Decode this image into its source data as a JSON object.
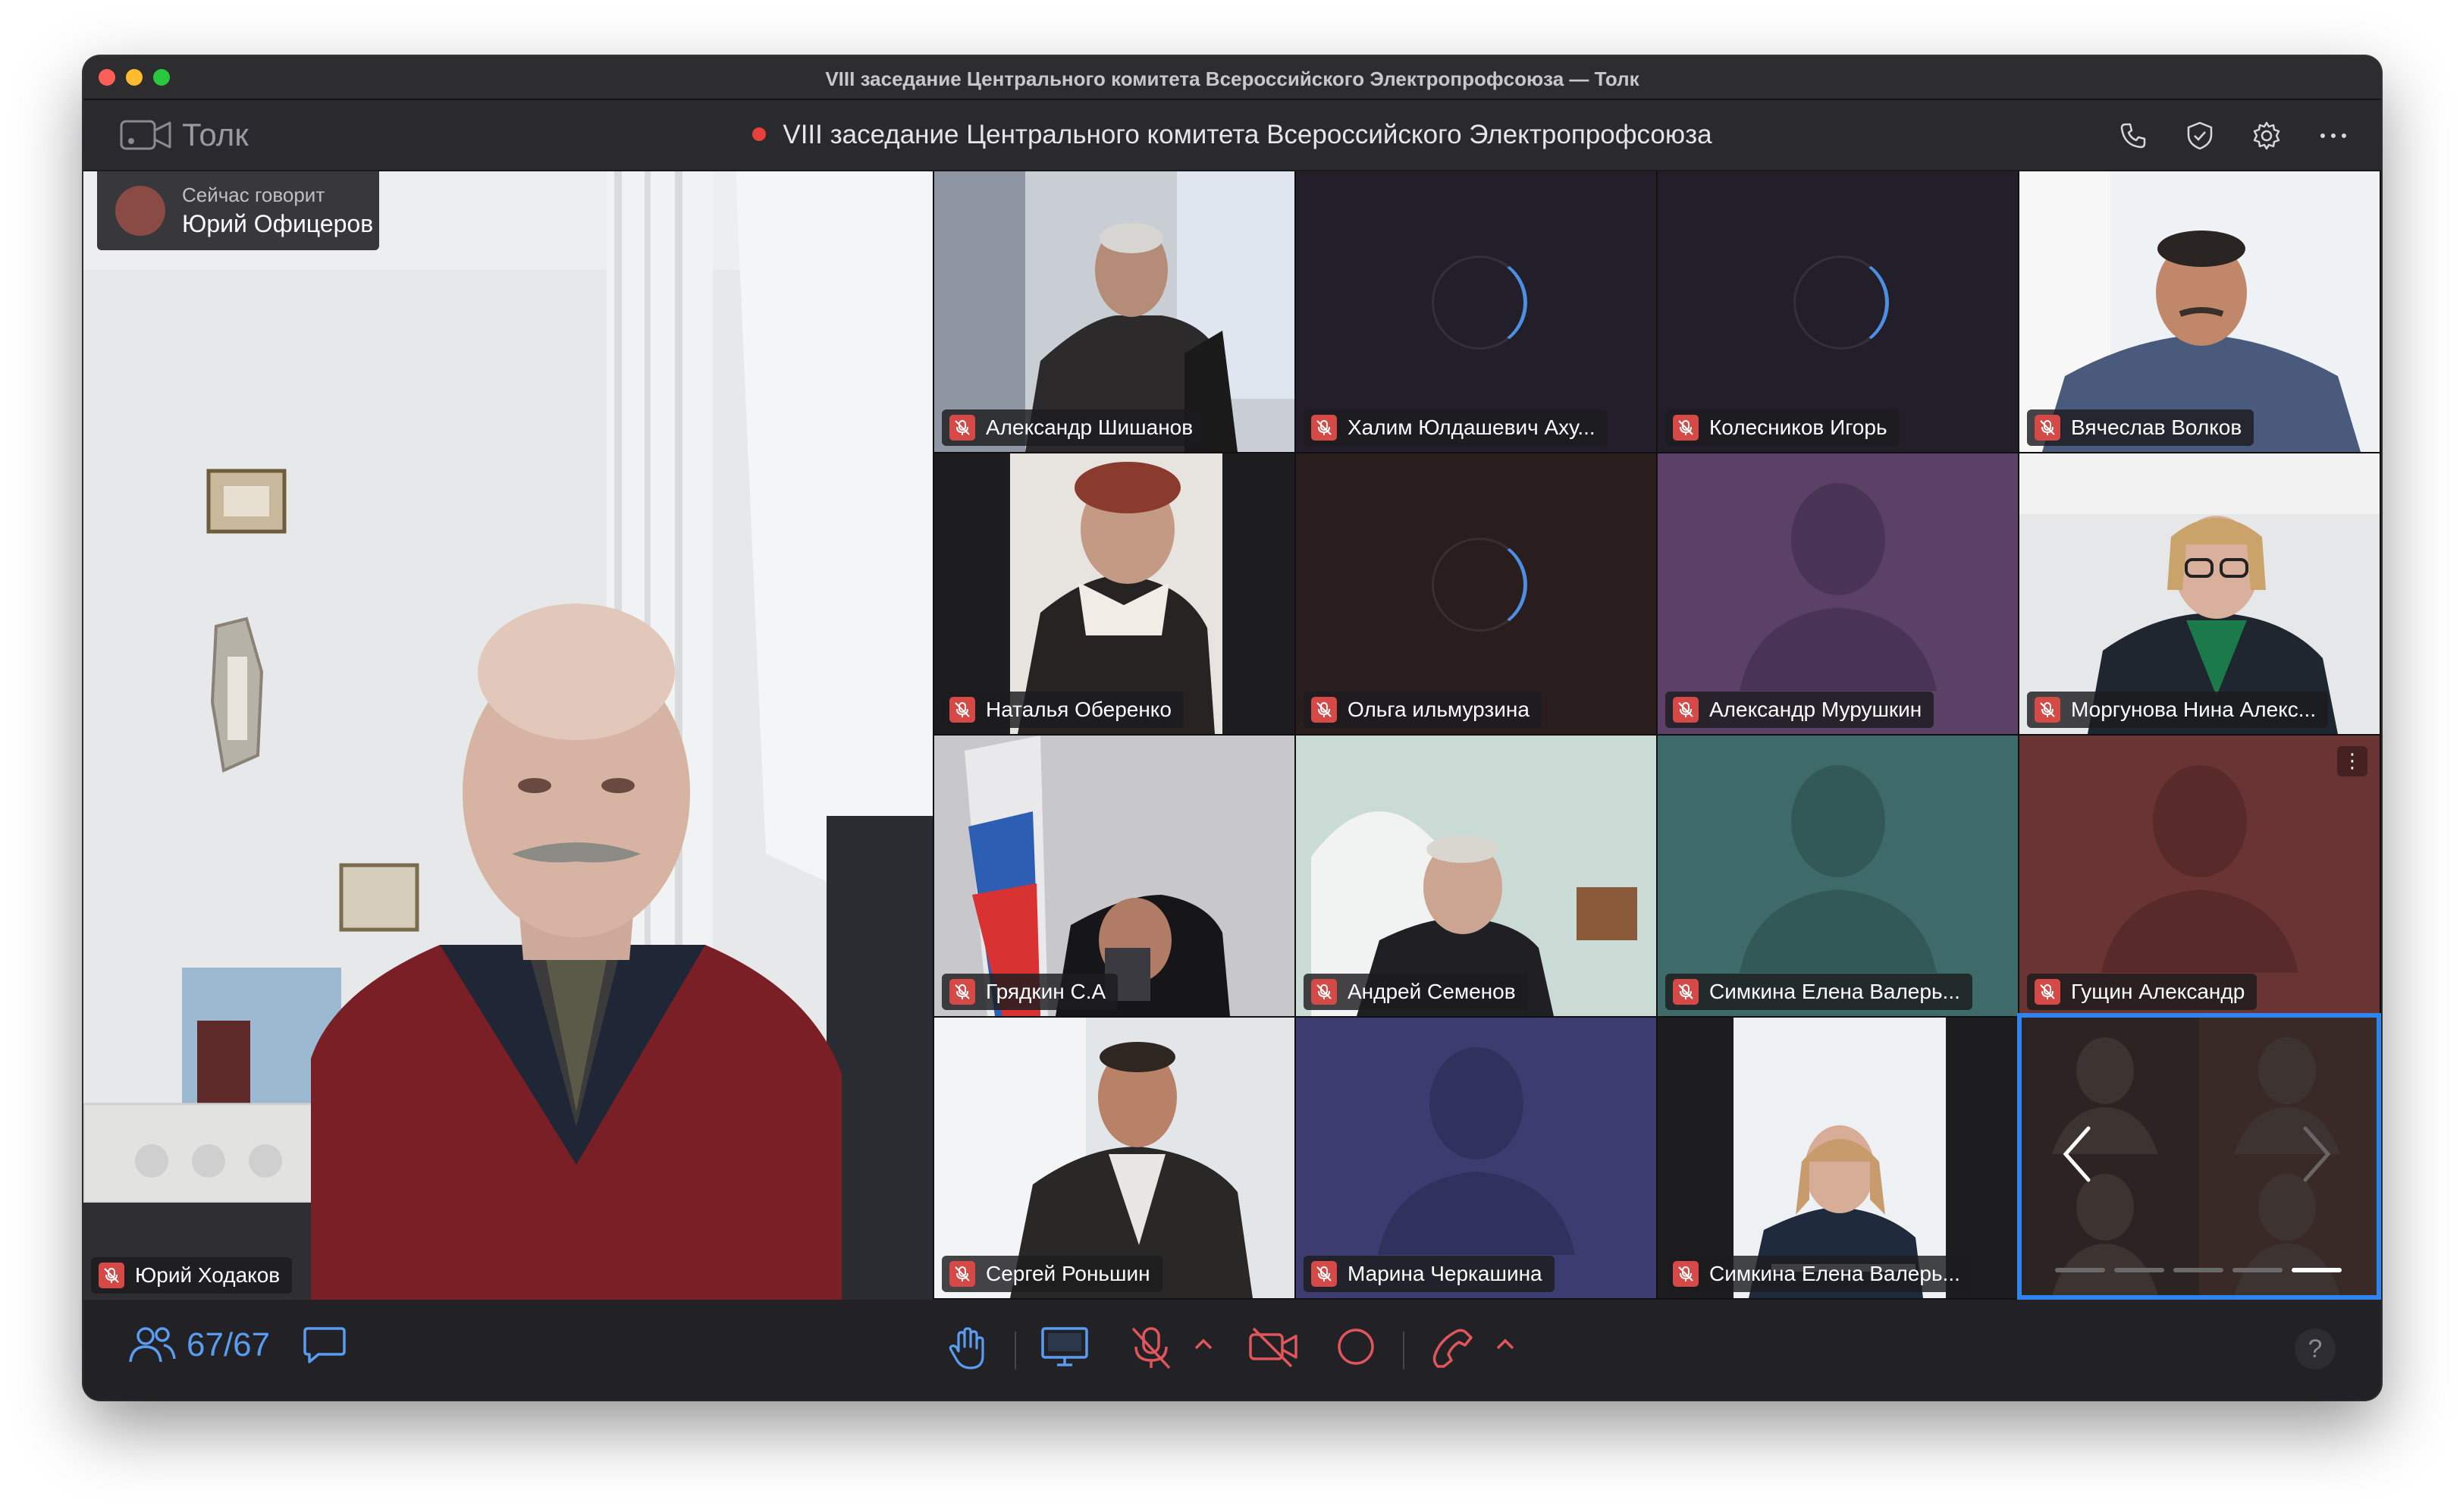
{
  "window": {
    "os_title": "VIII заседание Центрального комитета Всероссийского Электропрофсоюза — Толк"
  },
  "header": {
    "app_name": "Толк",
    "meeting_title": "VIII заседание Центрального комитета Всероссийского Электропрофсоюза",
    "record_color": "#e8403a",
    "icons": [
      "phone-icon",
      "shield-check-icon",
      "gear-icon",
      "more-horizontal-icon"
    ]
  },
  "main_video": {
    "speaking_label": "Сейчас говорит",
    "speaking_name": "Юрий Офицеров",
    "participant_name": "Юрий Ходаков"
  },
  "participants": [
    {
      "name": "Александр Шишанов",
      "state": "video"
    },
    {
      "name": "Халим Юлдашевич Аху...",
      "state": "loading"
    },
    {
      "name": "Колесников Игорь",
      "state": "loading"
    },
    {
      "name": "Вячеслав Волков",
      "state": "video"
    },
    {
      "name": "Наталья Оберенко",
      "state": "video"
    },
    {
      "name": "Ольга ильмурзина",
      "state": "loading"
    },
    {
      "name": "Александр Мурушкин",
      "state": "avatar"
    },
    {
      "name": "Моргунова Нина Алекс...",
      "state": "video"
    },
    {
      "name": "Грядкин С.А",
      "state": "video"
    },
    {
      "name": "Андрей Семенов",
      "state": "video"
    },
    {
      "name": "Симкина Елена Валерь...",
      "state": "avatar"
    },
    {
      "name": "Гущин Александр",
      "state": "avatar"
    },
    {
      "name": "Сергей Роньшин",
      "state": "video"
    },
    {
      "name": "Марина Черкашина",
      "state": "avatar"
    },
    {
      "name": "Симкина Елена Валерь...",
      "state": "video"
    }
  ],
  "pager": {
    "pages": 5,
    "current_page": 5
  },
  "toolbar": {
    "participant_count": "67/67",
    "help_label": "?",
    "colors": {
      "accent": "#5a9cf0",
      "muted": "#e0565a",
      "border": "#2f84f0"
    }
  }
}
